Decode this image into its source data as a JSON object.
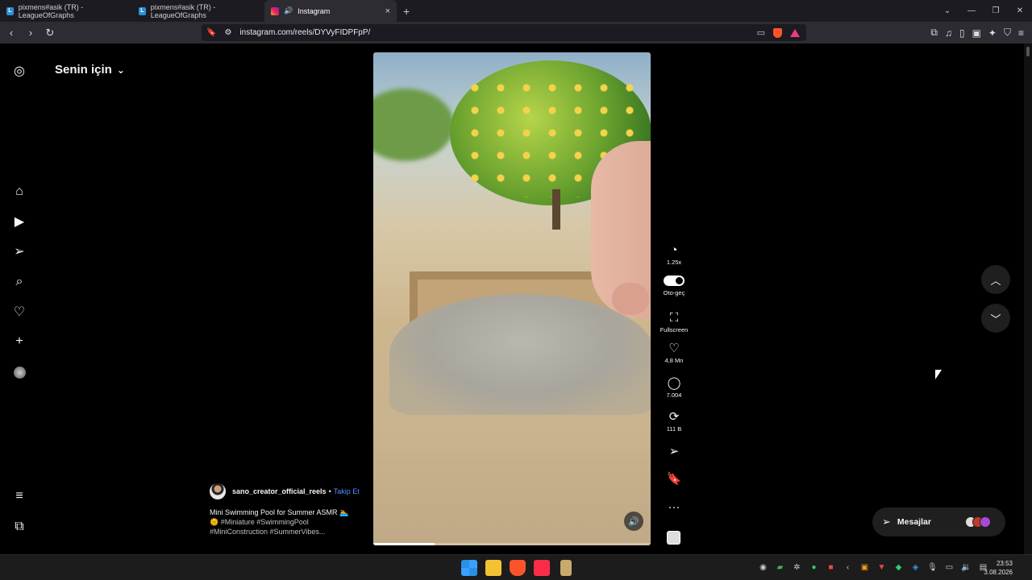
{
  "browser": {
    "tabs": [
      {
        "label": "pixmens#asik (TR) - LeagueOfGraphs",
        "icon": "L"
      },
      {
        "label": "pixmens#asik (TR) - LeagueOfGraphs",
        "icon": "L"
      },
      {
        "label": "Instagram",
        "icon": "instagram"
      }
    ],
    "url": "instagram.com/reels/DYVyFIDPFpP/",
    "new_tab": "+",
    "close_tab": "×",
    "back": "‹",
    "forward": "›",
    "reload": "↻"
  },
  "sidebar": {
    "items": [
      {
        "name": "instagram-logo-icon",
        "glyph": "◎"
      },
      {
        "name": "home-icon",
        "glyph": "⌂"
      },
      {
        "name": "reels-icon",
        "glyph": "▶"
      },
      {
        "name": "direct-icon",
        "glyph": "➢"
      },
      {
        "name": "search-icon",
        "glyph": "⌕"
      },
      {
        "name": "notifications-icon",
        "glyph": "♡"
      },
      {
        "name": "create-icon",
        "glyph": "+"
      },
      {
        "name": "more-icon",
        "glyph": "≡"
      },
      {
        "name": "threads-icon",
        "glyph": "⧉"
      }
    ]
  },
  "feed": {
    "title": "Senin için",
    "chevron": "⌄"
  },
  "reel": {
    "progress": 0.22,
    "actions": {
      "speed": "1.25x",
      "autoplay": "Oto-geç",
      "fullscreen": "Fullscreen",
      "likes": "4,8 Mn",
      "comments": "7.004",
      "reposts": "111 B",
      "more": "···"
    },
    "author": {
      "username": "sano_creator_official_reels",
      "separator": "•",
      "follow": "Takip Et"
    },
    "caption": {
      "line1": "Mini Swimming Pool for Summer ASMR 🏊",
      "line2": "🌞 #Miniature #SwimmingPool",
      "line3": "#MiniConstruction #SummerVibes..."
    }
  },
  "messages": {
    "label": "Mesajlar"
  },
  "clock": {
    "time": "23:53",
    "date": "3.08.2026"
  }
}
